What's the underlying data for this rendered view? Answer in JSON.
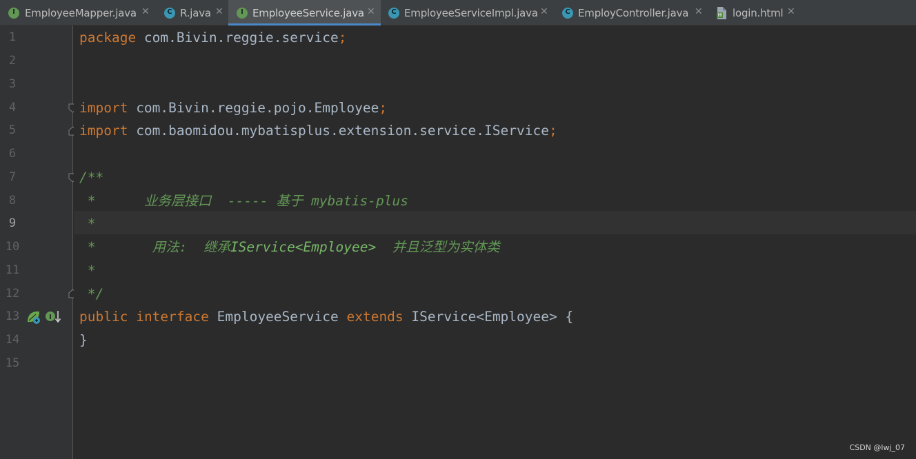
{
  "tabs": [
    {
      "label": "EmployeeMapper.java",
      "icon": "interface-file-icon",
      "active": false
    },
    {
      "label": "R.java",
      "icon": "class-file-icon",
      "active": false
    },
    {
      "label": "EmployeeService.java",
      "icon": "interface-file-icon",
      "active": true
    },
    {
      "label": "EmployeeServiceImpl.java",
      "icon": "class-file-icon",
      "active": false
    },
    {
      "label": "EmployController.java",
      "icon": "class-file-icon",
      "active": false
    },
    {
      "label": "login.html",
      "icon": "html-file-icon",
      "active": false
    }
  ],
  "icon_glyphs": {
    "interface": "I",
    "class": "C",
    "close": "✕"
  },
  "line_numbers": [
    "1",
    "2",
    "3",
    "4",
    "5",
    "6",
    "7",
    "8",
    "9",
    "10",
    "11",
    "12",
    "13",
    "14",
    "15"
  ],
  "current_line": "9",
  "code": {
    "line1": {
      "keyword": "package",
      "rest": " com.Bivin.reggie.service",
      "semicolon": ";"
    },
    "line4": {
      "keyword": "import",
      "rest": " com.Bivin.reggie.pojo.Employee",
      "semicolon": ";"
    },
    "line5": {
      "keyword": "import",
      "rest": " com.baomidou.mybatisplus.extension.service.IService",
      "semicolon": ";"
    },
    "line7": {
      "text": "/**"
    },
    "line8": {
      "text": " *      业务层接口  ----- 基于 mybatis-plus"
    },
    "line9": {
      "text": " *"
    },
    "line10": {
      "prefix": " *       用法:  继承",
      "tag": "IService<Employee>",
      "suffix": "  并且泛型为实体类"
    },
    "line11": {
      "text": " *"
    },
    "line12": {
      "text": " */"
    },
    "line13": {
      "kw1": "public",
      "kw2": "interface",
      "name": "EmployeeService",
      "kw3": "extends",
      "rest": "IService<Employee> {"
    },
    "line14": {
      "text": "}"
    }
  },
  "gutter_icons": [
    "implemented-by-bean-icon",
    "interface-implemented-icon"
  ],
  "watermark": "CSDN @lwj_07",
  "colors": {
    "background": "#2b2b2b",
    "keyword": "#cc7832",
    "identifier": "#a9b7c6",
    "doc_comment": "#629755",
    "active_tab_underline": "#4a88c7"
  }
}
